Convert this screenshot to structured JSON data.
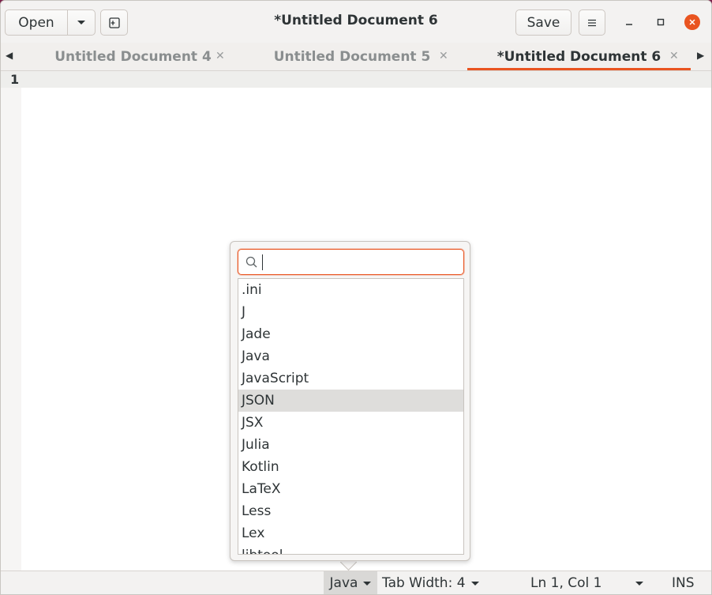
{
  "header": {
    "open_label": "Open",
    "save_label": "Save",
    "title": "*Untitled Document 6"
  },
  "tabs": [
    {
      "label": "Untitled Document 4",
      "active": false
    },
    {
      "label": "Untitled Document 5",
      "active": false
    },
    {
      "label": "*Untitled Document 6",
      "active": true
    }
  ],
  "editor": {
    "line_number": "1"
  },
  "language_popover": {
    "search_value": "",
    "items": [
      ".ini",
      "J",
      "Jade",
      "Java",
      "JavaScript",
      "JSON",
      "JSX",
      "Julia",
      "Kotlin",
      "LaTeX",
      "Less",
      "Lex",
      "libtool"
    ],
    "selected": "JSON"
  },
  "statusbar": {
    "language": "Java",
    "tab_width": "Tab Width: 4",
    "position": "Ln 1, Col 1",
    "insert_mode": "INS"
  },
  "colors": {
    "accent": "#e95420",
    "selected_row": "#dedddb"
  },
  "icons": {
    "open_menu": "chevron-down-icon",
    "new_tab": "new-tab-icon",
    "menu": "hamburger-menu-icon",
    "minimize": "minimize-icon",
    "maximize": "maximize-icon",
    "close": "close-icon",
    "search": "search-icon"
  }
}
